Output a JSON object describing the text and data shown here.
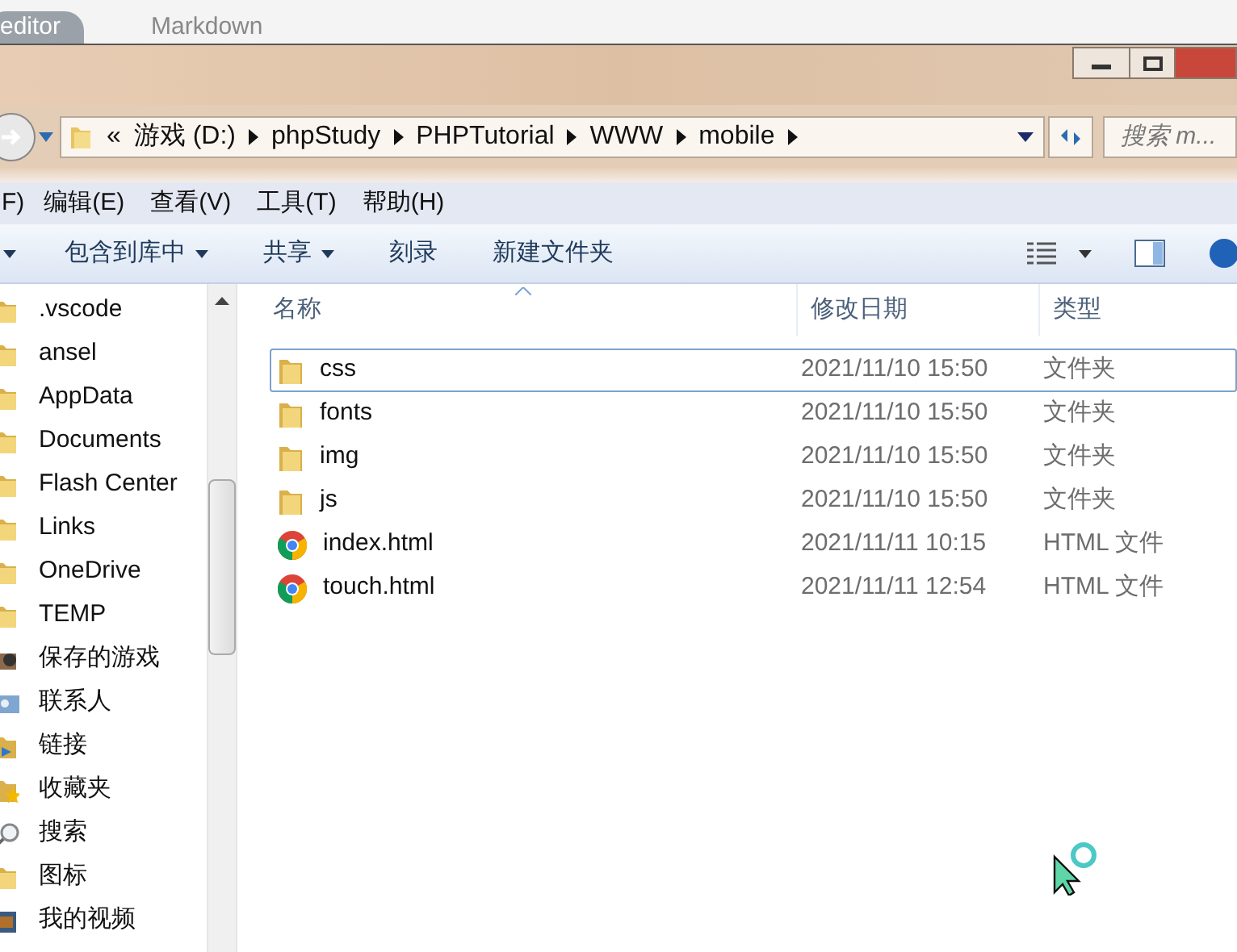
{
  "app_tabs": [
    {
      "label": "editor",
      "selected": true
    },
    {
      "label": "Markdown",
      "selected": false
    }
  ],
  "address_bar": {
    "segments": [
      "«",
      "游戏 (D:)",
      "phpStudy",
      "PHPTutorial",
      "WWW",
      "mobile"
    ]
  },
  "search": {
    "placeholder": "搜索 m..."
  },
  "menu_bar": [
    "F)",
    "编辑(E)",
    "查看(V)",
    "工具(T)",
    "帮助(H)"
  ],
  "toolbar": [
    {
      "dropdown": true
    },
    {
      "label": "包含到库中",
      "dropdown": true
    },
    {
      "label": "共享",
      "dropdown": true
    },
    {
      "label": "刻录",
      "dropdown": false
    },
    {
      "label": "新建文件夹",
      "dropdown": false
    }
  ],
  "sidebar": {
    "items": [
      {
        "label": ".vscode",
        "kind": "folder"
      },
      {
        "label": "ansel",
        "kind": "folder"
      },
      {
        "label": "AppData",
        "kind": "folder"
      },
      {
        "label": "Documents",
        "kind": "folder"
      },
      {
        "label": "Flash Center",
        "kind": "folder"
      },
      {
        "label": "Links",
        "kind": "folder"
      },
      {
        "label": "OneDrive",
        "kind": "folder"
      },
      {
        "label": "TEMP",
        "kind": "folder"
      },
      {
        "label": "保存的游戏",
        "kind": "games"
      },
      {
        "label": "联系人",
        "kind": "contacts"
      },
      {
        "label": "链接",
        "kind": "links"
      },
      {
        "label": "收藏夹",
        "kind": "favorites"
      },
      {
        "label": "搜索",
        "kind": "search"
      },
      {
        "label": "图标",
        "kind": "folder"
      },
      {
        "label": "我的视频",
        "kind": "videos"
      }
    ]
  },
  "file_list": {
    "columns": [
      "名称",
      "修改日期",
      "类型"
    ],
    "rows": [
      {
        "name": "css",
        "date": "2021/11/10 15:50",
        "type": "文件夹",
        "kind": "folder",
        "focused": true
      },
      {
        "name": "fonts",
        "date": "2021/11/10 15:50",
        "type": "文件夹",
        "kind": "folder",
        "focused": false
      },
      {
        "name": "img",
        "date": "2021/11/10 15:50",
        "type": "文件夹",
        "kind": "folder",
        "focused": false
      },
      {
        "name": "js",
        "date": "2021/11/10 15:50",
        "type": "文件夹",
        "kind": "folder",
        "focused": false
      },
      {
        "name": "index.html",
        "date": "2021/11/11 10:15",
        "type": "HTML 文件",
        "kind": "chrome",
        "focused": false
      },
      {
        "name": "touch.html",
        "date": "2021/11/11 12:54",
        "type": "HTML 文件",
        "kind": "chrome",
        "focused": false
      }
    ]
  }
}
